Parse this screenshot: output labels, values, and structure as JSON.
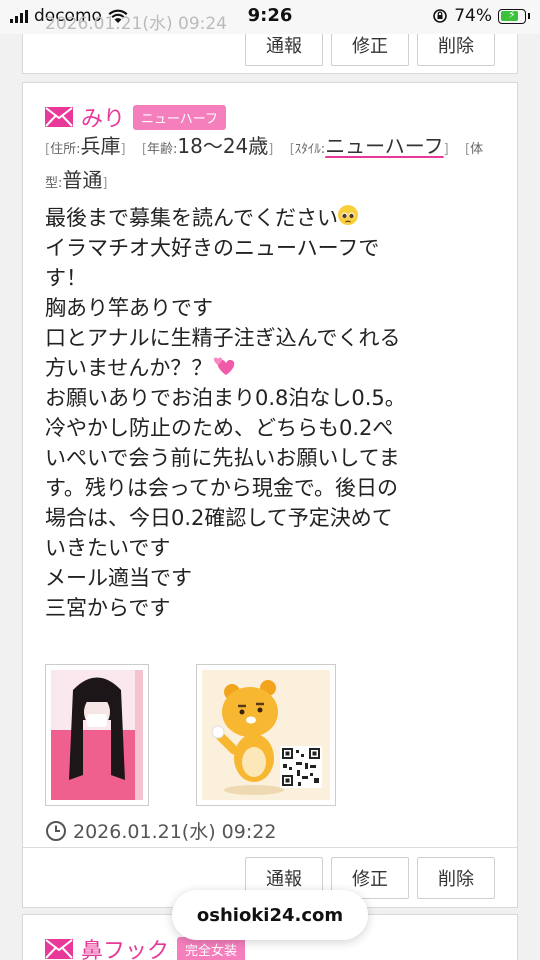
{
  "status_bar": {
    "carrier": "docomo",
    "time": "9:26",
    "battery_percent": "74%",
    "battery_level": 0.74
  },
  "prev_post": {
    "faded_date": "2026.01.21(水) 09:24",
    "actions": {
      "report": "通報",
      "edit": "修正",
      "delete": "削除"
    }
  },
  "post": {
    "name": "みり",
    "badge": "ニューハーフ",
    "attributes": [
      {
        "key": "住所:",
        "value": "兵庫",
        "underline": false
      },
      {
        "key": "年齢:",
        "value": "18〜24歳",
        "underline": false
      },
      {
        "key": "ｽﾀｲﾙ:",
        "value": "ニューハーフ",
        "underline": true
      },
      {
        "key": "体型:",
        "value": "普通",
        "underline": false
      }
    ],
    "body_line1": "最後まで募集を読んでください",
    "body_line2": "イラマチオ大好きのニューハーフで\nす！\n胸あり竿ありです\n口とアナルに生精子注ぎ込んでくれる\n方いませんか？？",
    "body_line3": "\nお願いありでお泊まり0.8泊なし0.5。\n冷やかし防止のため、どちらも0.2ぺ\nいぺいで会う前に先払いお願いしてま\nす。残りは会ってから現金で。後日の\n場合は、今日0.2確認して予定決めて\nいきたいです\nメール適当です\n三宮からです",
    "date": "2026.01.21(水) 09:22",
    "actions": {
      "report": "通報",
      "edit": "修正",
      "delete": "削除"
    }
  },
  "next_post": {
    "name": "鼻フック",
    "badge": "完全女装"
  },
  "domain_pill": "oshioki24.com",
  "colors": {
    "accent": "#e8399a",
    "badge_bg": "#f57fbd"
  }
}
